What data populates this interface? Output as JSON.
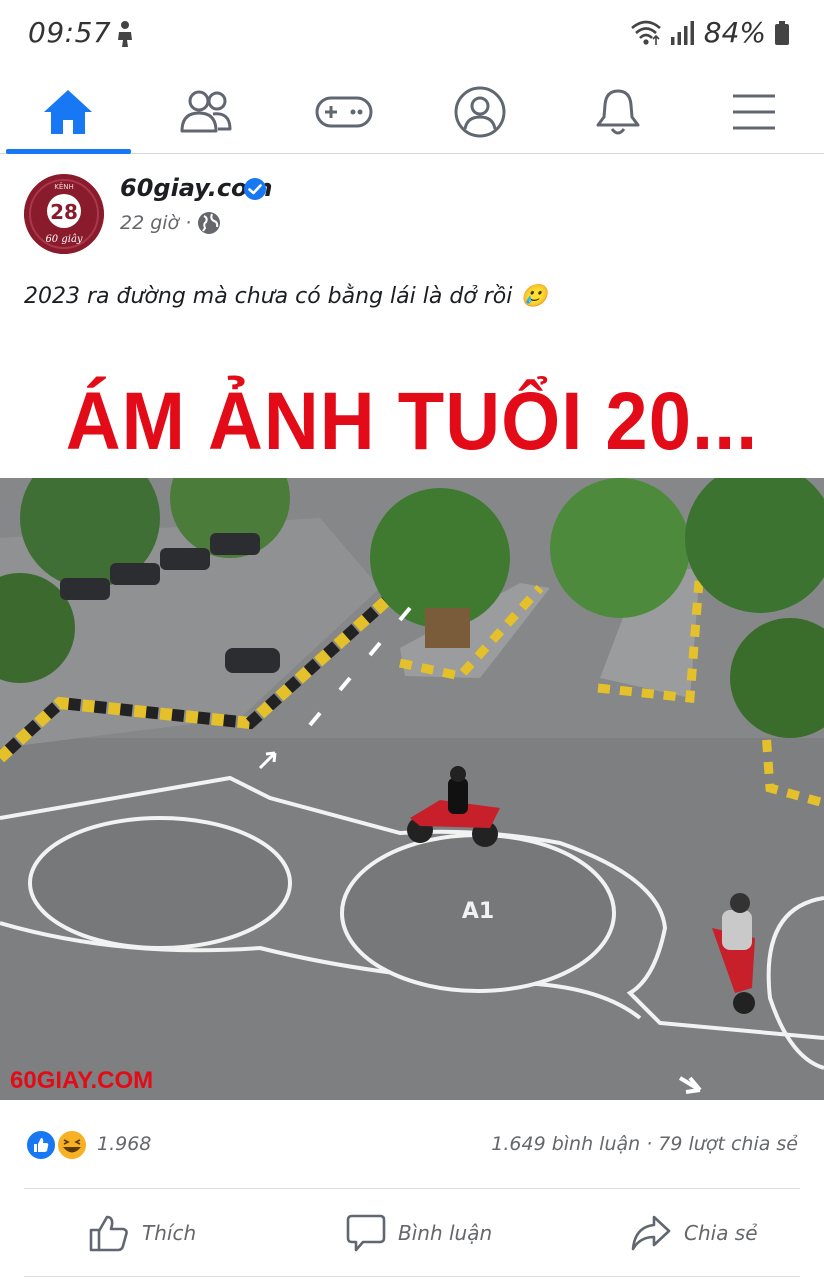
{
  "status_bar": {
    "time": "09:57",
    "battery": "84%",
    "icons": [
      "person-icon",
      "wifi-icon",
      "signal-icon",
      "battery-icon"
    ]
  },
  "nav": {
    "items": [
      {
        "name": "home",
        "icon": "home-icon",
        "active": true
      },
      {
        "name": "friends",
        "icon": "friends-icon",
        "active": false
      },
      {
        "name": "gaming",
        "icon": "gamepad-icon",
        "active": false
      },
      {
        "name": "profile",
        "icon": "profile-icon",
        "active": false
      },
      {
        "name": "notifications",
        "icon": "bell-icon",
        "active": false
      },
      {
        "name": "menu",
        "icon": "menu-icon",
        "active": false
      }
    ],
    "active_color": "#1877f2"
  },
  "post": {
    "page_name": "60giay.com",
    "time": "22 giờ",
    "separator": "·",
    "caption": "2023 ra đường mà chưa có bằng lái là dở rồi",
    "caption_emoji": "🥲",
    "image": {
      "headline": "ÁM ẢNH TUỔI 20...",
      "watermark": "60GIAY.COM",
      "track_marking": "A1",
      "avatar_text_top": "KÊNH",
      "avatar_number": "28",
      "avatar_text_bottom": "60 giây"
    },
    "reactions": {
      "count": "1.968",
      "stats": "1.649 bình luận · 79 lượt chia sẻ"
    },
    "actions": {
      "like": "Thích",
      "comment": "Bình luận",
      "share": "Chia sẻ"
    }
  }
}
